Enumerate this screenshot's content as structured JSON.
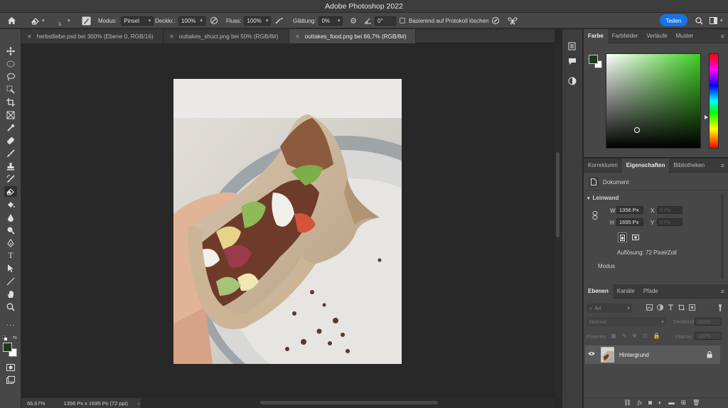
{
  "window": {
    "title": "Adobe Photoshop 2022"
  },
  "options_bar": {
    "brush_size": "1",
    "mode_label": "Modus:",
    "mode_value": "Pinsel",
    "opacity_label": "Deckkr.:",
    "opacity_value": "100%",
    "flow_label": "Fluss:",
    "flow_value": "100%",
    "smoothing_label": "Glättung:",
    "smoothing_value": "0%",
    "angle_value": "0°",
    "history_label": "Basierend auf Protokoll löschen",
    "share_label": "Teilen"
  },
  "tabs": [
    {
      "label": "herbstliebe.psd bei 300% (Ebene 0, RGB/16)",
      "active": false
    },
    {
      "label": "outtakes_shuct.png bei 50% (RGB/8#)",
      "active": false
    },
    {
      "label": "outtakes_food.png bei 66,7% (RGB/8#)",
      "active": true
    }
  ],
  "status": {
    "zoom": "66,67%",
    "doc_info": "1356 Px x 1695 Px (72 ppi)"
  },
  "color_panel": {
    "tabs": [
      "Farbe",
      "Farbfelder",
      "Verläufe",
      "Muster"
    ],
    "foreground": "#1f3a1f",
    "background": "#ffffff",
    "hue_color": "#3ed023"
  },
  "properties_panel": {
    "tabs": [
      "Korrekturen",
      "Eigenschaften",
      "Bibliotheken"
    ],
    "doc_label": "Dokument",
    "canvas_label": "Leinwand",
    "w_label": "W",
    "w_value": "1356 Px",
    "h_label": "H",
    "h_value": "1695 Px",
    "x_label": "X",
    "x_value": "0 Px",
    "y_label": "Y",
    "y_value": "0 Px",
    "resolution": "Auflösung: 72 Pixel/Zoll",
    "mode_label": "Modus"
  },
  "layers_panel": {
    "tabs": [
      "Ebenen",
      "Kanäle",
      "Pfade"
    ],
    "search_placeholder": "Art",
    "blend_mode": "Normal",
    "opacity_label": "Deckkraft:",
    "opacity_value": "100%",
    "lock_label": "Fixieren:",
    "fill_label": "Fläche:",
    "fill_value": "100%",
    "layers": [
      {
        "name": "Hintergrund",
        "visible": true,
        "locked": true
      }
    ]
  }
}
